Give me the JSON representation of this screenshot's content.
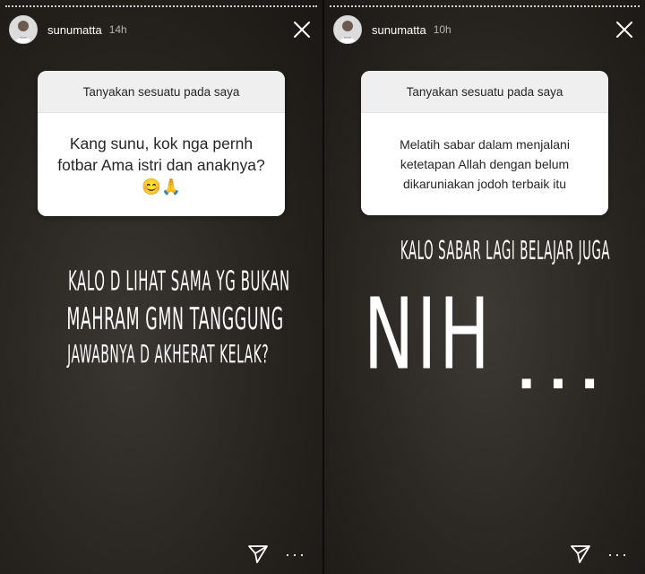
{
  "stories": [
    {
      "username": "sunumatta",
      "time": "14h",
      "question_header": "Tanyakan sesuatu pada saya",
      "question_body": "Kang sunu, kok nga pernh fotbar Ama istri dan anaknya?😊🙏",
      "caption_lines": [
        "KALO D LIHAT SAMA YG BUKAN",
        "MAHRAM GMN TANGGUNG",
        "JAWABNYA D AKHERAT KELAK?"
      ]
    },
    {
      "username": "sunumatta",
      "time": "10h",
      "question_header": "Tanyakan sesuatu pada saya",
      "question_body": "Melatih sabar dalam menjalani ketetapan Allah dengan belum dikaruniakan jodoh terbaik itu",
      "caption_line": "KALO SABAR LAGI BELAJAR JUGA",
      "big_text": "NIH",
      "dots": "..."
    }
  ],
  "icons": [
    "close-icon",
    "send-icon",
    "more-icon"
  ],
  "colors": {
    "card_header": "#efefef",
    "card_body": "#ffffff",
    "text_light": "#ffffff"
  }
}
